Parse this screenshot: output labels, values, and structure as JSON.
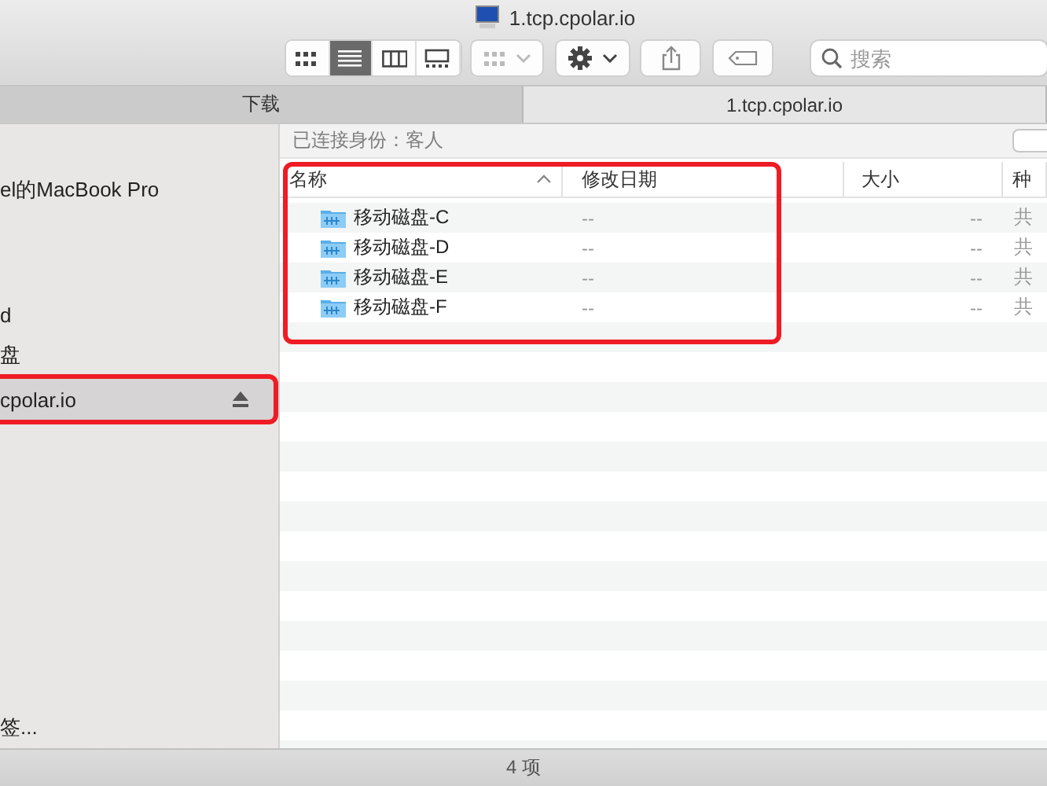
{
  "window": {
    "title": "1.tcp.cpolar.io"
  },
  "toolbar": {
    "views": [
      {
        "kind": "icon",
        "selected": false
      },
      {
        "kind": "list",
        "selected": true
      },
      {
        "kind": "column",
        "selected": false
      },
      {
        "kind": "gallery",
        "selected": false
      }
    ],
    "arrange": {
      "disabled": true
    },
    "search": {
      "placeholder": "搜索"
    }
  },
  "tabs": [
    {
      "label": "下载",
      "selected": false
    },
    {
      "label": "1.tcp.cpolar.io",
      "selected": true
    }
  ],
  "sidebar": {
    "groups": [
      {
        "items": [
          {
            "label": "el的MacBook Pro",
            "selected": false,
            "highlighted": false,
            "ejectable": false
          }
        ]
      },
      {
        "items": [
          {
            "label": "d",
            "selected": false,
            "highlighted": false,
            "ejectable": false
          },
          {
            "label": "盘",
            "selected": false,
            "highlighted": false,
            "ejectable": false
          },
          {
            "label": "cpolar.io",
            "selected": true,
            "highlighted": true,
            "ejectable": true
          }
        ]
      },
      {
        "items": [
          {
            "label": "签...",
            "selected": false,
            "highlighted": false,
            "ejectable": false
          }
        ]
      }
    ]
  },
  "connected_as": "已连接身份：客人",
  "table": {
    "highlighted": true,
    "columns": [
      {
        "label": "名称",
        "sorted": true
      },
      {
        "label": "修改日期",
        "sorted": false
      },
      {
        "label": "大小",
        "sorted": false
      },
      {
        "label": "种",
        "sorted": false
      }
    ],
    "rows": [
      {
        "name": "移动磁盘-C",
        "date": "--",
        "size": "--",
        "kind": "共"
      },
      {
        "name": "移动磁盘-D",
        "date": "--",
        "size": "--",
        "kind": "共"
      },
      {
        "name": "移动磁盘-E",
        "date": "--",
        "size": "--",
        "kind": "共"
      },
      {
        "name": "移动磁盘-F",
        "date": "--",
        "size": "--",
        "kind": "共"
      }
    ]
  },
  "status_bar": "4 项"
}
